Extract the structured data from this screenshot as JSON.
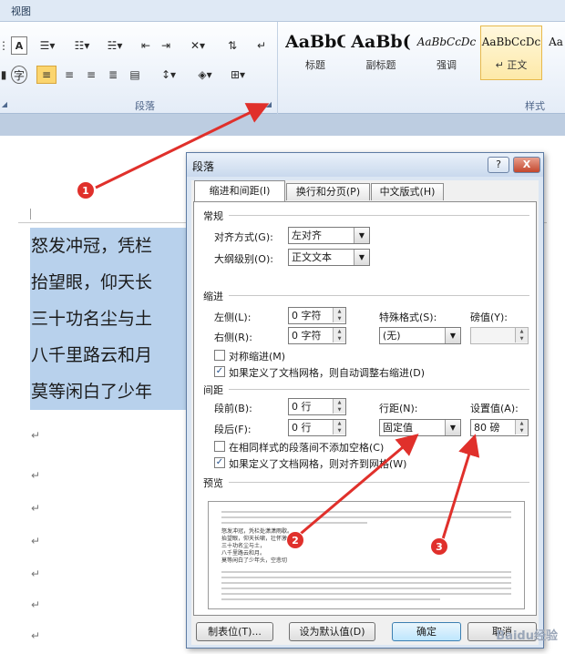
{
  "ribbon": {
    "tab_label": "视图",
    "paragraph_group_label": "段落",
    "styles_group_label": "样式",
    "launcher_icon": "dialog-launcher-icon",
    "styles": [
      {
        "preview": "AaBbC(",
        "name": "标题"
      },
      {
        "preview": "AaBb(",
        "name": "副标题"
      },
      {
        "preview": "AaBbCcDc",
        "name": "强调"
      },
      {
        "preview": "AaBbCcDc",
        "name": "↵ 正文"
      },
      {
        "preview": "Aa",
        "name": ""
      }
    ],
    "highlight_color": "#fbd56e"
  },
  "document": {
    "lines": [
      "怒发冲冠，凭栏",
      "抬望眼，仰天长",
      "三十功名尘与土",
      "八千里路云和月",
      "莫等闲白了少年"
    ],
    "paragraph_mark": "↵",
    "selection_color": "#b8d1ec"
  },
  "dialog": {
    "title": "段落",
    "help_label": "?",
    "close_label": "X",
    "tabs": [
      "缩进和间距(I)",
      "换行和分页(P)",
      "中文版式(H)"
    ],
    "general": {
      "section": "常规",
      "alignment_label": "对齐方式(G):",
      "alignment_value": "左对齐",
      "outline_label": "大纲级别(O):",
      "outline_value": "正文文本"
    },
    "indent": {
      "section": "缩进",
      "left_label": "左侧(L):",
      "left_value": "0 字符",
      "right_label": "右侧(R):",
      "right_value": "0 字符",
      "special_label": "特殊格式(S):",
      "special_value": "(无)",
      "by_label": "磅值(Y):",
      "by_value": "",
      "mirror_label": "对称缩进(M)",
      "mirror_checked": false,
      "auto_adjust_label": "如果定义了文档网格，则自动调整右缩进(D)",
      "auto_adjust_checked": true
    },
    "spacing": {
      "section": "间距",
      "before_label": "段前(B):",
      "before_value": "0 行",
      "after_label": "段后(F):",
      "after_value": "0 行",
      "line_spacing_label": "行距(N):",
      "line_spacing_value": "固定值",
      "at_label": "设置值(A):",
      "at_value": "80 磅",
      "no_space_label": "在相同样式的段落间不添加空格(C)",
      "no_space_checked": false,
      "snap_grid_label": "如果定义了文档网格，则对齐到网格(W)",
      "snap_grid_checked": true
    },
    "preview": {
      "section": "预览",
      "sample_lines": [
        "怒发冲冠，凭栏处潇潇雨歇。",
        "抬望眼，仰天长啸，壮怀激烈。",
        "三十功名尘与土，",
        "八千里路云和月。",
        "莫等闲白了少年头，空悲切"
      ]
    },
    "buttons": {
      "tabs": "制表位(T)...",
      "default": "设为默认值(D)",
      "ok": "确定",
      "cancel": "取消"
    }
  },
  "annotations": {
    "markers": [
      "1",
      "2",
      "3"
    ],
    "arrow_color": "#e0302b"
  },
  "watermark": "Baidu经验"
}
